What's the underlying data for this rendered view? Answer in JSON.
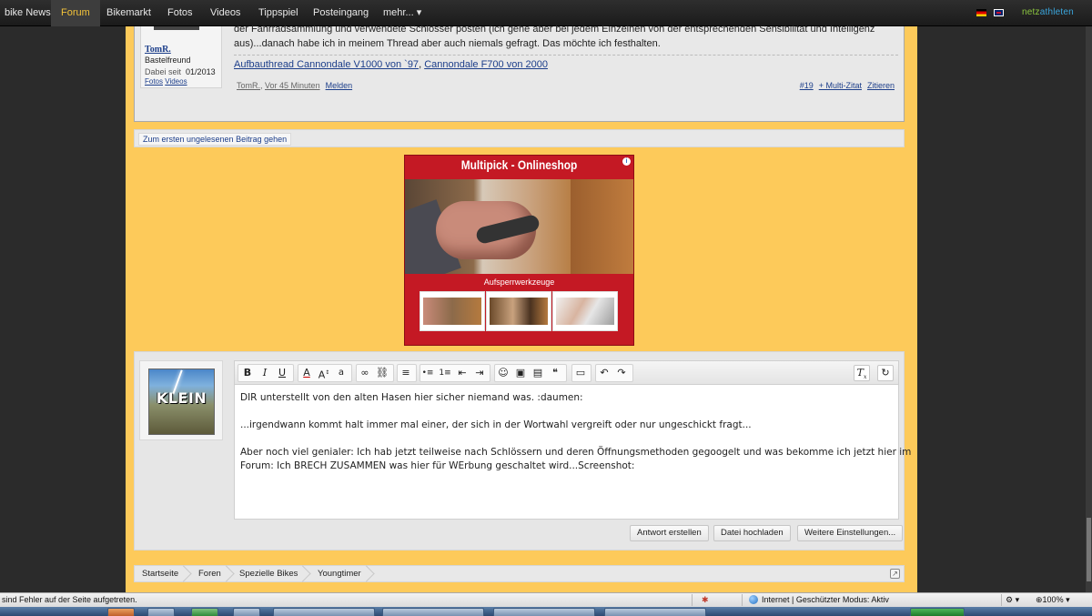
{
  "nav": {
    "items": [
      "bike News",
      "Forum",
      "Bikemarkt",
      "Fotos",
      "Videos",
      "Tippspiel",
      "Posteingang",
      "mehr..."
    ],
    "more_caret": "▾",
    "active": "Forum",
    "brand_part1": "netz",
    "brand_part2": "athleten"
  },
  "post": {
    "line1": "der Fahrradsammlung und verwendete Schlösser posten (ich gehe aber bei jedem Einzelnen von der entsprechenden Sensibilität und Intelligenz",
    "line2": "aus)...danach habe ich in meinem Thread aber auch niemals gefragt. Das möchte ich festhalten.",
    "signature_link1": "Aufbauthread Cannondale V1000 von `97",
    "signature_sep": ", ",
    "signature_link2": "Cannondale F700 von 2000",
    "author": {
      "name": "TomR.",
      "rank": "Bastelfreund",
      "joined_label": "Dabei seit",
      "joined_value": "01/2013",
      "link_photos": "Fotos",
      "link_videos": "Videos"
    },
    "footer_author": "TomR.",
    "footer_sep": ", ",
    "footer_time": "Vor 45 Minuten",
    "footer_report": "Melden",
    "post_number": "#19",
    "multi_quote": "+ Multi-Zitat",
    "quote": "Zitieren"
  },
  "unread_button": "Zum ersten ungelesenen Beitrag gehen",
  "ad": {
    "title": "Multipick - Onlineshop",
    "info": "i",
    "caption": "Aufsperrwerkzeuge"
  },
  "editor": {
    "toolbar": {
      "bold": "B",
      "italic": "I",
      "underline": "U",
      "font_color": "A",
      "font_size": "A",
      "font_size_sup": "↕",
      "font_family": "a",
      "link": "∞",
      "unlink": "⛓",
      "align": "≡",
      "bullet_list": "•≡",
      "numbered_list": "1≡",
      "outdent": "⇤",
      "indent": "⇥",
      "smiley": "☺",
      "image": "▣",
      "media": "▤",
      "quote": "❝",
      "save": "▭",
      "undo": "↶",
      "redo": "↷",
      "remove_format": "T",
      "remove_format_sub": "x",
      "toggle_mode": "↻"
    },
    "paragraphs": [
      "DIR unterstellt von den alten Hasen hier sicher niemand was. :daumen:",
      "...irgendwann kommt halt immer mal einer, der sich in der Wortwahl vergreift oder nur ungeschickt fragt...",
      "Aber noch viel genialer: Ich hab jetzt teilweise nach Schlössern und deren Öffnungsmethoden gegoogelt und was bekomme ich jetzt hier im",
      "Forum: Ich BRECH ZUSAMMEN was hier für WErbung geschaltet wird...Screenshot:"
    ],
    "avatar_text": "KLEIN",
    "buttons": {
      "submit": "Antwort erstellen",
      "upload": "Datei hochladen",
      "more": "Weitere Einstellungen..."
    }
  },
  "breadcrumb": [
    "Startseite",
    "Foren",
    "Spezielle Bikes",
    "Youngtimer"
  ],
  "breadcrumb_icon": "↗",
  "statusbar": {
    "error_text": "sind Fehler auf der Seite aufgetreten.",
    "zone_text": "Internet | Geschützter Modus: Aktiv",
    "zoom": "100%",
    "zoom_caret": "▾",
    "shield_icon": "⚙",
    "settings_caret": "▾"
  },
  "colors": {
    "page_bg": "#fdca5a",
    "nav_active": "#f2c23a",
    "link": "#1c3e8a",
    "ad_red": "#c41924"
  }
}
